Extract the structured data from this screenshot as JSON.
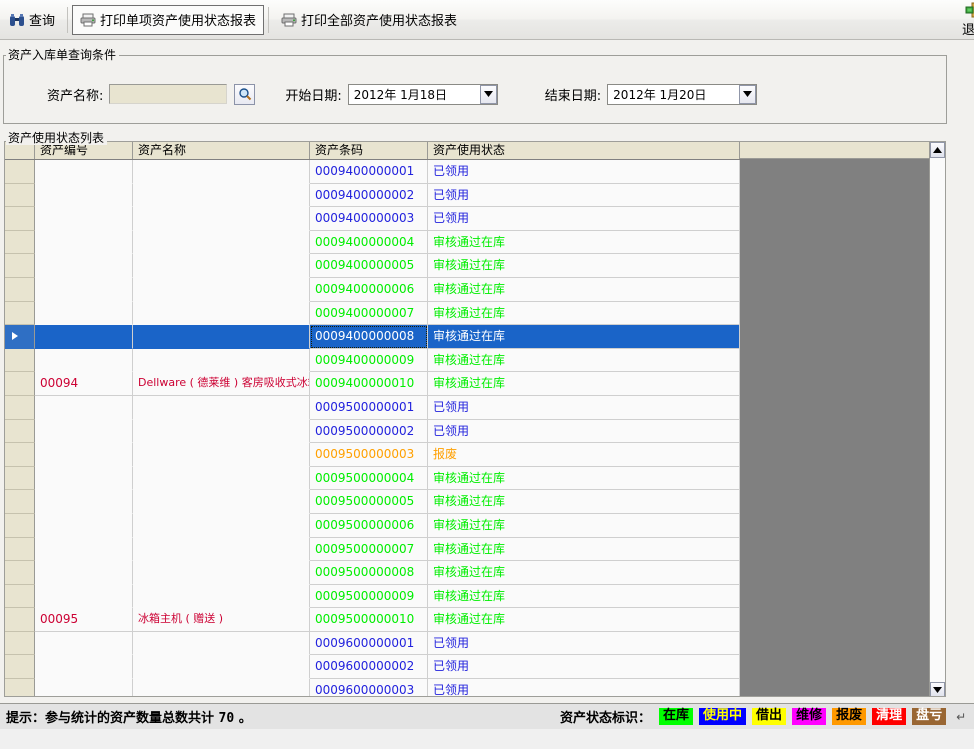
{
  "toolbar": {
    "buttons": [
      {
        "id": "query",
        "label": "查询",
        "icon": "binoculars-icon",
        "selected": false
      },
      {
        "id": "print-single",
        "label": "打印单项资产使用状态报表",
        "icon": "printer-icon",
        "selected": true
      },
      {
        "id": "print-all",
        "label": "打印全部资产使用状态报表",
        "icon": "printer-icon",
        "selected": false
      }
    ],
    "exit": {
      "label": "退出",
      "icon": "exit-door-icon"
    }
  },
  "query_group": {
    "title": "资产入库单查询条件",
    "asset_name": {
      "label": "资产名称:",
      "value": "",
      "placeholder": "",
      "search_icon": "magnifier-icon"
    },
    "start_date": {
      "label": "开始日期:",
      "value": "2012年 1月18日",
      "arrow_icon": "chevron-down-icon"
    },
    "end_date": {
      "label": "结束日期:",
      "value": "2012年 1月20日",
      "arrow_icon": "chevron-down-icon"
    }
  },
  "list_group": {
    "title": "资产使用状态列表",
    "columns": [
      {
        "key": "rowhdr",
        "label": ""
      },
      {
        "key": "code",
        "label": "资产编号"
      },
      {
        "key": "name",
        "label": "资产名称"
      },
      {
        "key": "barcode",
        "label": "资产条码"
      },
      {
        "key": "status",
        "label": "资产使用状态"
      }
    ],
    "status_colors": {
      "已领用": "#2222dd",
      "审核通过在库": "#00ee00",
      "报废": "#ffa000"
    },
    "rows": [
      {
        "code": "",
        "name": "",
        "barcode": "0009400000001",
        "status": "已领用",
        "color": "#2222dd",
        "selected": false
      },
      {
        "code": "",
        "name": "",
        "barcode": "0009400000002",
        "status": "已领用",
        "color": "#2222dd",
        "selected": false
      },
      {
        "code": "",
        "name": "",
        "barcode": "0009400000003",
        "status": "已领用",
        "color": "#2222dd",
        "selected": false
      },
      {
        "code": "",
        "name": "",
        "barcode": "0009400000004",
        "status": "审核通过在库",
        "color": "#00ee00",
        "selected": false
      },
      {
        "code": "",
        "name": "",
        "barcode": "0009400000005",
        "status": "审核通过在库",
        "color": "#00ee00",
        "selected": false
      },
      {
        "code": "",
        "name": "",
        "barcode": "0009400000006",
        "status": "审核通过在库",
        "color": "#00ee00",
        "selected": false
      },
      {
        "code": "",
        "name": "",
        "barcode": "0009400000007",
        "status": "审核通过在库",
        "color": "#00ee00",
        "selected": false
      },
      {
        "code": "",
        "name": "",
        "barcode": "0009400000008",
        "status": "审核通过在库",
        "color": "#00ee00",
        "selected": true
      },
      {
        "code": "",
        "name": "",
        "barcode": "0009400000009",
        "status": "审核通过在库",
        "color": "#00ee00",
        "selected": false
      },
      {
        "code": "00094",
        "name": "Dellware ( 德莱维 ) 客房吸收式冰箱",
        "barcode": "0009400000010",
        "status": "审核通过在库",
        "color": "#00ee00",
        "selected": false
      },
      {
        "code": "",
        "name": "",
        "barcode": "0009500000001",
        "status": "已领用",
        "color": "#2222dd",
        "selected": false
      },
      {
        "code": "",
        "name": "",
        "barcode": "0009500000002",
        "status": "已领用",
        "color": "#2222dd",
        "selected": false
      },
      {
        "code": "",
        "name": "",
        "barcode": "0009500000003",
        "status": "报废",
        "color": "#ffa000",
        "selected": false
      },
      {
        "code": "",
        "name": "",
        "barcode": "0009500000004",
        "status": "审核通过在库",
        "color": "#00ee00",
        "selected": false
      },
      {
        "code": "",
        "name": "",
        "barcode": "0009500000005",
        "status": "审核通过在库",
        "color": "#00ee00",
        "selected": false
      },
      {
        "code": "",
        "name": "",
        "barcode": "0009500000006",
        "status": "审核通过在库",
        "color": "#00ee00",
        "selected": false
      },
      {
        "code": "",
        "name": "",
        "barcode": "0009500000007",
        "status": "审核通过在库",
        "color": "#00ee00",
        "selected": false
      },
      {
        "code": "",
        "name": "",
        "barcode": "0009500000008",
        "status": "审核通过在库",
        "color": "#00ee00",
        "selected": false
      },
      {
        "code": "",
        "name": "",
        "barcode": "0009500000009",
        "status": "审核通过在库",
        "color": "#00ee00",
        "selected": false
      },
      {
        "code": "00095",
        "name": "冰箱主机 ( 赠送 )",
        "barcode": "0009500000010",
        "status": "审核通过在库",
        "color": "#00ee00",
        "selected": false
      },
      {
        "code": "",
        "name": "",
        "barcode": "0009600000001",
        "status": "已领用",
        "color": "#2222dd",
        "selected": false
      },
      {
        "code": "",
        "name": "",
        "barcode": "0009600000002",
        "status": "已领用",
        "color": "#2222dd",
        "selected": false
      },
      {
        "code": "",
        "name": "",
        "barcode": "0009600000003",
        "status": "已领用",
        "color": "#2222dd",
        "selected": false
      }
    ],
    "scrollbar": {
      "up_icon": "chevron-up-icon",
      "down_icon": "chevron-down-icon"
    }
  },
  "statusbar": {
    "hint_prefix": "提示：参与统计的资产数量总数共计",
    "hint_count": "70",
    "hint_suffix": "。",
    "legend_title": "资产状态标识：",
    "legend": [
      {
        "label": "在库",
        "bg": "#00ff00",
        "fg": "#000000"
      },
      {
        "label": "使用中",
        "bg": "#0000ff",
        "fg": "#ffff00"
      },
      {
        "label": "借出",
        "bg": "#ffff00",
        "fg": "#000000"
      },
      {
        "label": "维修",
        "bg": "#ff00ff",
        "fg": "#000000"
      },
      {
        "label": "报废",
        "bg": "#ff9900",
        "fg": "#000000"
      },
      {
        "label": "清理",
        "bg": "#ff0000",
        "fg": "#ffffff"
      },
      {
        "label": "盘亏",
        "bg": "#996633",
        "fg": "#ffffff"
      }
    ],
    "trailing_mark": "↵"
  }
}
